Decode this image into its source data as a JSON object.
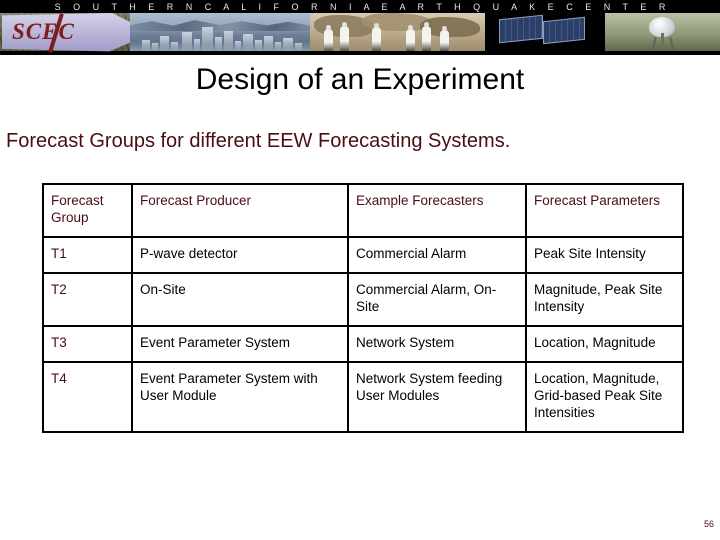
{
  "banner": {
    "org_title": "S O U T H E R N   C A L I F O R N I A   E A R T H Q U A K E   C E N T E R",
    "logo_text": "SCEC"
  },
  "slide": {
    "title": "Design of an Experiment",
    "subtitle": "Forecast Groups for different EEW Forecasting Systems.",
    "page_number": "56"
  },
  "colors": {
    "maroon": "#4a0d12",
    "logo_red": "#7d1d21",
    "banner_bg": "#000000",
    "border": "#000000"
  },
  "table": {
    "headers": [
      "Forecast Group",
      "Forecast Producer",
      "Example Forecasters",
      "Forecast Parameters"
    ],
    "rows": [
      {
        "group": "T1",
        "producer": "P-wave detector",
        "forecasters": "Commercial Alarm",
        "parameters": "Peak Site Intensity"
      },
      {
        "group": "T2",
        "producer": "On-Site",
        "forecasters": "Commercial Alarm, On-Site",
        "parameters": "Magnitude, Peak Site Intensity"
      },
      {
        "group": "T3",
        "producer": "Event  Parameter System",
        "forecasters": "Network System",
        "parameters": "Location, Magnitude"
      },
      {
        "group": "T4",
        "producer": "Event Parameter System with User Module",
        "forecasters": "Network System feeding User Modules",
        "parameters": "Location, Magnitude, Grid-based Peak Site Intensities"
      }
    ]
  }
}
